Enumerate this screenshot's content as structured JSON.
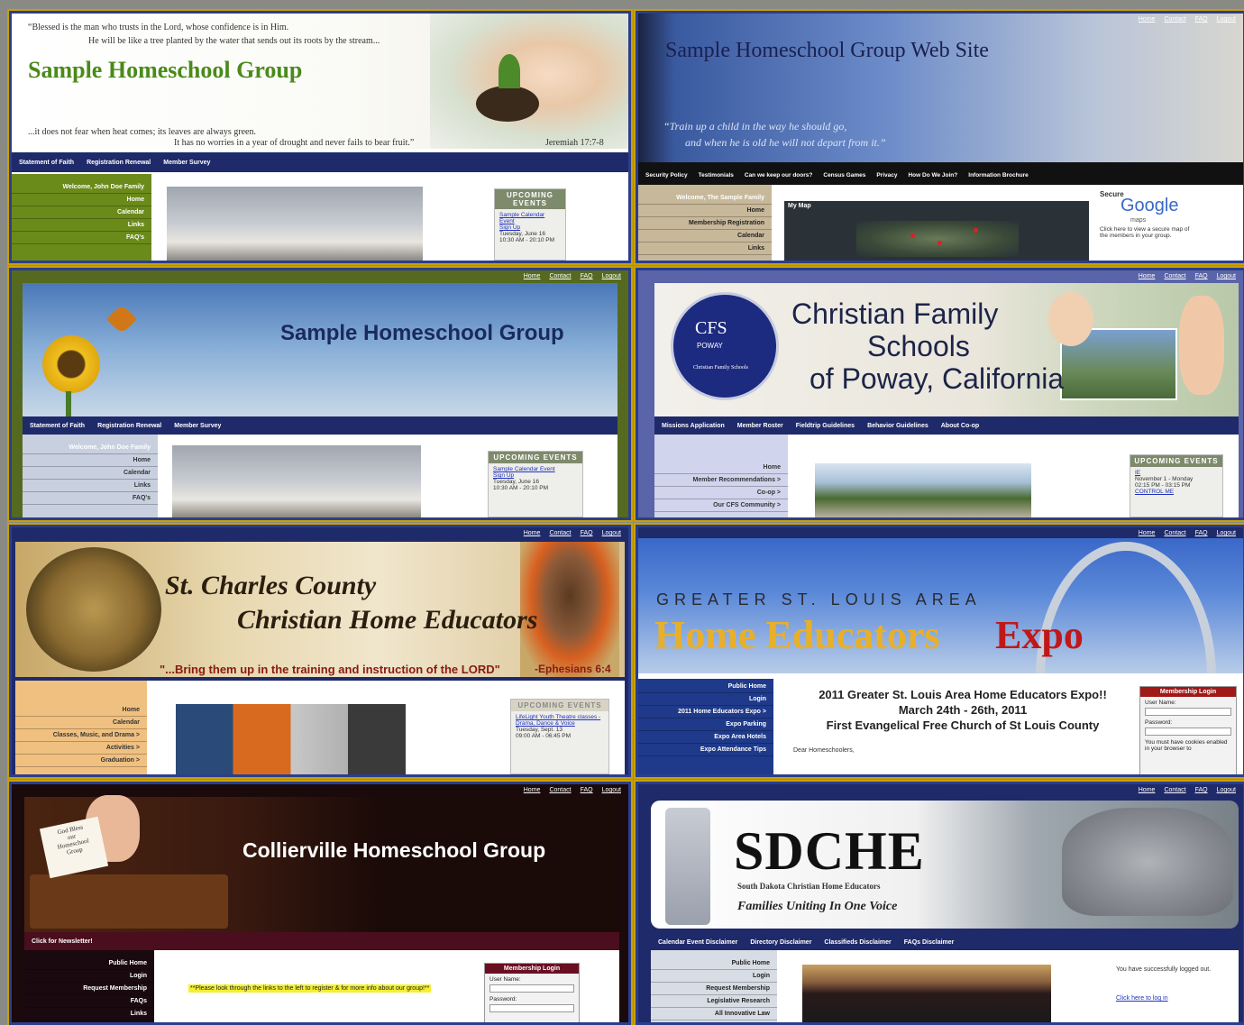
{
  "tile1": {
    "verse_top": "“Blessed is the man who trusts in the Lord, whose confidence is in Him.",
    "verse_top2": "He will be like a tree planted by the water that sends out its roots by the stream...",
    "title": "Sample Homeschool Group",
    "verse_bottom": "...it does not fear when heat comes; its leaves are always green.",
    "verse_bottom2": "It has no worries in a year of drought and never fails to bear fruit.”",
    "verse_ref": "Jeremiah 17:7-8",
    "nav": [
      "Statement of Faith",
      "Registration Renewal",
      "Member Survey"
    ],
    "side": [
      "Welcome, John Doe Family",
      "Home",
      "Calendar",
      "Links",
      "FAQ's"
    ],
    "events_title": "UPCOMING EVENTS",
    "events": [
      "Sample Calendar Event",
      "Sign Up",
      "Tuesday, June 16",
      "10:30 AM - 20:10 PM"
    ]
  },
  "tile2": {
    "title": "Sample Homeschool Group Web Site",
    "verse1": "“Train up a child in the way he should go,",
    "verse2": "and when he is old he will not depart from it.”",
    "toplinks": [
      "Home",
      "Contact",
      "FAQ",
      "Logout"
    ],
    "nav": [
      "Security Policy",
      "Testimonials",
      "Can we keep our doors?",
      "Census Games",
      "Privacy",
      "How Do We Join?",
      "Information Brochure"
    ],
    "side": [
      "Welcome, The Sample Family",
      "Home",
      "Membership Registration",
      "Calendar",
      "Links"
    ],
    "map_title": "My Map",
    "google_top": "Secure",
    "google": "Google",
    "google_sub": "maps",
    "google_text": "Click here to view a secure map of the members in your group."
  },
  "tile3": {
    "title": "Sample Homeschool Group",
    "toplinks": [
      "Home",
      "Contact",
      "FAQ",
      "Logout"
    ],
    "nav": [
      "Statement of Faith",
      "Registration Renewal",
      "Member Survey"
    ],
    "side": [
      "Welcome, John Doe Family",
      "Home",
      "Calendar",
      "Links",
      "FAQ's"
    ],
    "events_title": "UPCOMING EVENTS",
    "events": [
      "Sample Calendar Event",
      "Sign Up",
      "Tuesday, June 16",
      "10:30 AM - 20:10 PM"
    ]
  },
  "tile4": {
    "title1": "Christian Family",
    "title2": "Schools",
    "title3": "of Poway, California",
    "logo_text": "CFS",
    "logo_sub": "POWAY",
    "logo_caption": "Christian Family Schools",
    "toplinks": [
      "Home",
      "Contact",
      "FAQ",
      "Logout"
    ],
    "nav": [
      "Missions Application",
      "Member Roster",
      "Fieldtrip Guidelines",
      "Behavior Guidelines",
      "About Co-op"
    ],
    "side": [
      "Home",
      "Member Recommendations >",
      "Co-op >",
      "Our CFS Community >"
    ],
    "events_title": "UPCOMING EVENTS",
    "events": [
      "IE",
      "November 1 - Monday",
      "02:15 PM - 03:15 PM",
      "CONTROL ME"
    ]
  },
  "tile5": {
    "title1": "St. Charles County",
    "title2": "Christian Home Educators",
    "verse": "\"...Bring them up in the training and instruction of the LORD\"",
    "verse_ref": "-Ephesians 6:4",
    "toplinks": [
      "Home",
      "Contact",
      "FAQ",
      "Logout"
    ],
    "side": [
      "Home",
      "Calendar",
      "Classes, Music, and Drama >",
      "Activities >",
      "Graduation >"
    ],
    "events_title": "UPCOMING EVENTS",
    "events": [
      "LifeLight Youth Theatre classes - Drama, Dance & Voice",
      "Tuesday, Sept. 13",
      "09:00 AM - 06:45 PM"
    ]
  },
  "tile6": {
    "pretitle": "GREATER ST. LOUIS AREA",
    "title_a": "Home Educators",
    "title_b": "Expo",
    "toplinks": [
      "Home",
      "Contact",
      "FAQ",
      "Logout"
    ],
    "side": [
      "Public Home",
      "Login",
      "2011 Home Educators Expo >",
      "Expo Parking",
      "Expo Area Hotels",
      "Expo Attendance Tips"
    ],
    "headline1": "2011 Greater St. Louis Area Home Educators Expo!!",
    "headline2": "March 24th - 26th, 2011",
    "headline3": "First Evangelical Free Church of St Louis County",
    "greeting": "Dear Homeschoolers,",
    "login_title": "Membership Login",
    "user_label": "User Name:",
    "pass_label": "Password:",
    "cookie_text": "You must have cookies enabled in your browser to"
  },
  "tile7": {
    "title": "Collierville Homeschool Group",
    "sign1": "God Bless",
    "sign2": "our",
    "sign3": "Homeschool",
    "sign4": "Group",
    "toplinks": [
      "Home",
      "Contact",
      "FAQ",
      "Logout"
    ],
    "newsletter": "Click for Newsletter!",
    "side": [
      "Public Home",
      "Login",
      "Request Membership",
      "FAQs",
      "Links"
    ],
    "notice": "**Please look through the links to the left to register & for more info about our group!**",
    "login_title": "Membership Login",
    "user_label": "User Name:",
    "pass_label": "Password:"
  },
  "tile8": {
    "title": "SDCHE",
    "subtitle": "South Dakota Christian Home Educators",
    "tagline": "Families Uniting In One Voice",
    "toplinks": [
      "Home",
      "Contact",
      "FAQ",
      "Logout"
    ],
    "nav": [
      "Calendar Event Disclaimer",
      "Directory Disclaimer",
      "Classifieds Disclaimer",
      "FAQs Disclaimer"
    ],
    "side": [
      "Public Home",
      "Login",
      "Request Membership",
      "Legislative Research",
      "All Innovative Law"
    ],
    "logout_msg": "You have successfully logged out.",
    "login_link": "Click here to log in"
  }
}
